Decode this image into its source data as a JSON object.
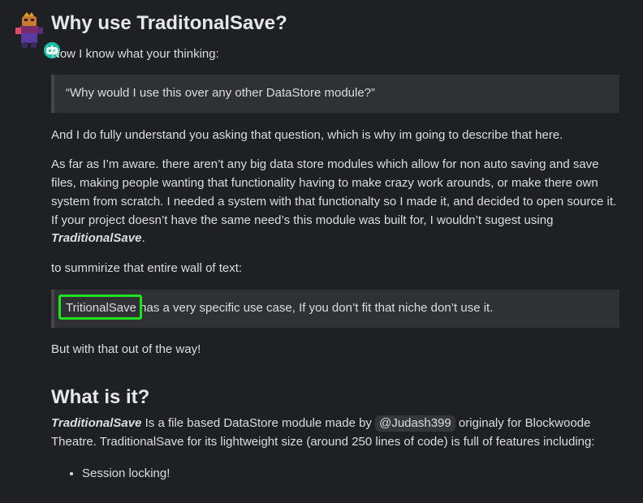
{
  "post": {
    "heading1": "Why use TraditonalSave?",
    "intro": "Now I know what your thinking:",
    "quote1": "“Why would I use this over any other DataStore module?”",
    "para1": "And I do fully understand you asking that question, which is why im going to describe that here.",
    "para2_text": "As far as I’m aware. there aren’t any big data store modules which allow for non auto saving and save files, making people wanting that functionality having to make crazy work arounds, or make there own system from scratch. I needed a system with that functionalty so I made it, and decided to open source it. If your project doesn’t have the same need’s this module was built for, I wouldn’t sugest using ",
    "para2_em": "TraditionalSave",
    "para2_end": ".",
    "para3": "to summirize that entire wall of text:",
    "quote2_highlight": "TritionalSave",
    "quote2_rest": " has a very specific use case, If you don’t fit that niche don’t use it.",
    "para4": "But with that out of the way!",
    "heading2": "What is it?",
    "para5_em": "TraditionalSave",
    "para5_a": " Is a file based DataStore module made by ",
    "para5_mention": "@Judash399",
    "para5_b": " originaly for Blockwoode Theatre. TraditionalSave for its lightweight size (around 250 lines of code) is full of features including:",
    "list": [
      "Session locking!"
    ]
  },
  "colors": {
    "background": "#1f2023",
    "quote_bg": "#303134",
    "highlight": "#1ee31e",
    "badge": "#18c0a8"
  },
  "icons": {
    "avatar": "user-avatar",
    "badge": "bot-badge-icon"
  }
}
